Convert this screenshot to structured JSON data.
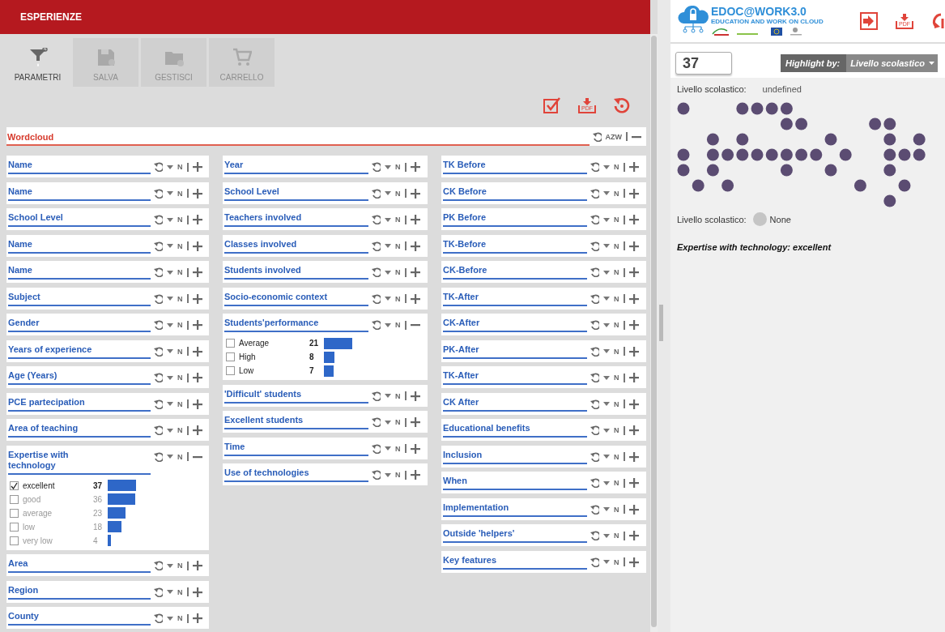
{
  "app_bar": {
    "title": "ESPERIENZE"
  },
  "tabs": [
    {
      "label": "PARAMETRI",
      "kind": "funnel",
      "selected": true,
      "disabled": false
    },
    {
      "label": "SALVA",
      "kind": "floppy",
      "selected": false,
      "disabled": true
    },
    {
      "label": "GESTISCI",
      "kind": "folder",
      "selected": false,
      "disabled": true
    },
    {
      "label": "CARRELLO",
      "kind": "cart",
      "selected": false,
      "disabled": true
    }
  ],
  "actions": [
    {
      "kind": "check"
    },
    {
      "kind": "pdf",
      "label": "PDF"
    },
    {
      "kind": "reset"
    }
  ],
  "wordcloud": {
    "title": "Wordcloud",
    "sort": "AZW",
    "expanded": true
  },
  "columns": [
    [
      {
        "title": "Name",
        "sort": "N",
        "expanded": false
      },
      {
        "title": "Name",
        "sort": "N",
        "expanded": false
      },
      {
        "title": "School Level",
        "sort": "N",
        "expanded": false
      },
      {
        "title": "Name",
        "sort": "N",
        "expanded": false
      },
      {
        "title": "Name",
        "sort": "N",
        "expanded": false
      },
      {
        "title": "Subject",
        "sort": "N",
        "expanded": false
      },
      {
        "title": "Gender",
        "sort": "N",
        "expanded": false
      },
      {
        "title": "Years of experience",
        "sort": "N",
        "expanded": false
      },
      {
        "title": "Age (Years)",
        "sort": "N",
        "expanded": false
      },
      {
        "title": "PCE partecipation",
        "sort": "N",
        "expanded": false
      },
      {
        "title": "Area of teaching",
        "sort": "N",
        "expanded": false
      },
      {
        "title": "Expertise with technology",
        "sort": "N",
        "expanded": true,
        "items": [
          {
            "label": "excellent",
            "count": "37",
            "checked": true
          },
          {
            "label": "good",
            "count": "36",
            "checked": false
          },
          {
            "label": "average",
            "count": "23",
            "checked": false
          },
          {
            "label": "low",
            "count": "18",
            "checked": false
          },
          {
            "label": "very low",
            "count": "4",
            "checked": false
          }
        ]
      },
      {
        "title": "Area",
        "sort": "N",
        "expanded": false
      },
      {
        "title": "Region",
        "sort": "N",
        "expanded": false
      },
      {
        "title": "County",
        "sort": "N",
        "expanded": false
      }
    ],
    [
      {
        "title": "Year",
        "sort": "N",
        "expanded": false
      },
      {
        "title": "School Level",
        "sort": "N",
        "expanded": false
      },
      {
        "title": "Teachers involved",
        "sort": "N",
        "expanded": false
      },
      {
        "title": "Classes involved",
        "sort": "N",
        "expanded": false
      },
      {
        "title": "Students involved",
        "sort": "N",
        "expanded": false
      },
      {
        "title": "Socio-economic context",
        "sort": "N",
        "expanded": false
      },
      {
        "title": "Students'performance",
        "sort": "N",
        "expanded": true,
        "items": [
          {
            "label": "Average",
            "count": "21",
            "checked": false
          },
          {
            "label": "High",
            "count": "8",
            "checked": false
          },
          {
            "label": "Low",
            "count": "7",
            "checked": false
          }
        ]
      },
      {
        "title": "'Difficult' students",
        "sort": "N",
        "expanded": false
      },
      {
        "title": "Excellent students",
        "sort": "N",
        "expanded": false
      },
      {
        "title": "Time",
        "sort": "N",
        "expanded": false
      },
      {
        "title": "Use of technologies",
        "sort": "N",
        "expanded": false
      }
    ],
    [
      {
        "title": "TK Before",
        "sort": "N",
        "expanded": false
      },
      {
        "title": "CK Before",
        "sort": "N",
        "expanded": false
      },
      {
        "title": "PK Before",
        "sort": "N",
        "expanded": false
      },
      {
        "title": "TK-Before",
        "sort": "N",
        "expanded": false
      },
      {
        "title": "CK-Before",
        "sort": "N",
        "expanded": false
      },
      {
        "title": "TK-After",
        "sort": "N",
        "expanded": false
      },
      {
        "title": "CK-After",
        "sort": "N",
        "expanded": false
      },
      {
        "title": "PK-After",
        "sort": "N",
        "expanded": false
      },
      {
        "title": "TK-After",
        "sort": "N",
        "expanded": false
      },
      {
        "title": "CK After",
        "sort": "N",
        "expanded": false
      },
      {
        "title": "Educational benefits",
        "sort": "N",
        "expanded": false
      },
      {
        "title": "Inclusion",
        "sort": "N",
        "expanded": false
      },
      {
        "title": "When",
        "sort": "N",
        "expanded": false
      },
      {
        "title": "Implementation",
        "sort": "N",
        "expanded": false
      },
      {
        "title": "Outside 'helpers'",
        "sort": "N",
        "expanded": false
      },
      {
        "title": "Key features",
        "sort": "N",
        "expanded": false
      }
    ]
  ],
  "logo": {
    "title": "EDOC@WORK3.0",
    "subtitle": "EDUCATION AND WORK ON CLOUD"
  },
  "header_actions": [
    {
      "kind": "login"
    },
    {
      "kind": "pdf",
      "label": "PDF"
    },
    {
      "kind": "sync"
    }
  ],
  "count_field": {
    "value": "37"
  },
  "highlight": {
    "label": "Highlight by:",
    "value": "Livello scolastico"
  },
  "legend_top": {
    "label": "Livello scolastico:",
    "value": "undefined"
  },
  "legend_bottom": {
    "label": "Livello scolastico:",
    "value": "None"
  },
  "summary": "Expertise with technology: excellent"
}
